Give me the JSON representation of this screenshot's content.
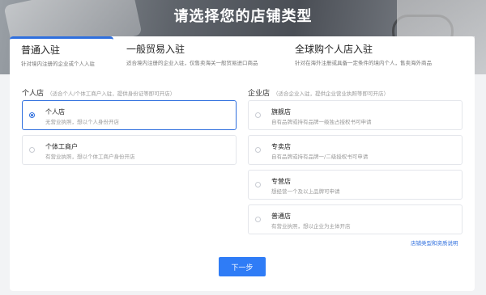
{
  "header": {
    "title": "请选择您的店铺类型"
  },
  "tabs": [
    {
      "label": "普通入驻",
      "desc": "针对境内注册的企业或个人入驻"
    },
    {
      "label": "一般贸易入驻",
      "desc": "适合境内注册的企业入驻，仅售卖海关一般贸易进口商品"
    },
    {
      "label": "全球购个人店入驻",
      "desc": "针对在海外注册或具备一定条件的境内个人，售卖海外商品"
    }
  ],
  "personal": {
    "title": "个人店",
    "hint": "（适合个人/个体工商户入驻，提供身份证等即可开店）",
    "options": [
      {
        "name": "个人店",
        "desc": "无营业执照，想以个人身份开店",
        "selected": true
      },
      {
        "name": "个体工商户",
        "desc": "有营业执照，想以个体工商户身份开店",
        "selected": false
      }
    ]
  },
  "enterprise": {
    "title": "企业店",
    "hint": "（适合企业入驻，提供企业营业执照等即可开店）",
    "options": [
      {
        "name": "旗舰店",
        "desc": "自有品牌或持有品牌一级独占授权书可申请"
      },
      {
        "name": "专卖店",
        "desc": "自有品牌或持有品牌一/二级授权书可申请"
      },
      {
        "name": "专营店",
        "desc": "想经营一个及以上品牌可申请"
      },
      {
        "name": "普通店",
        "desc": "有营业执照，想以企业为主体开店"
      }
    ]
  },
  "footer": {
    "link": "店铺类型和资质说明",
    "next_button": "下一步"
  },
  "colors": {
    "accent": "#2f6fde",
    "button": "#2f7cf6"
  }
}
